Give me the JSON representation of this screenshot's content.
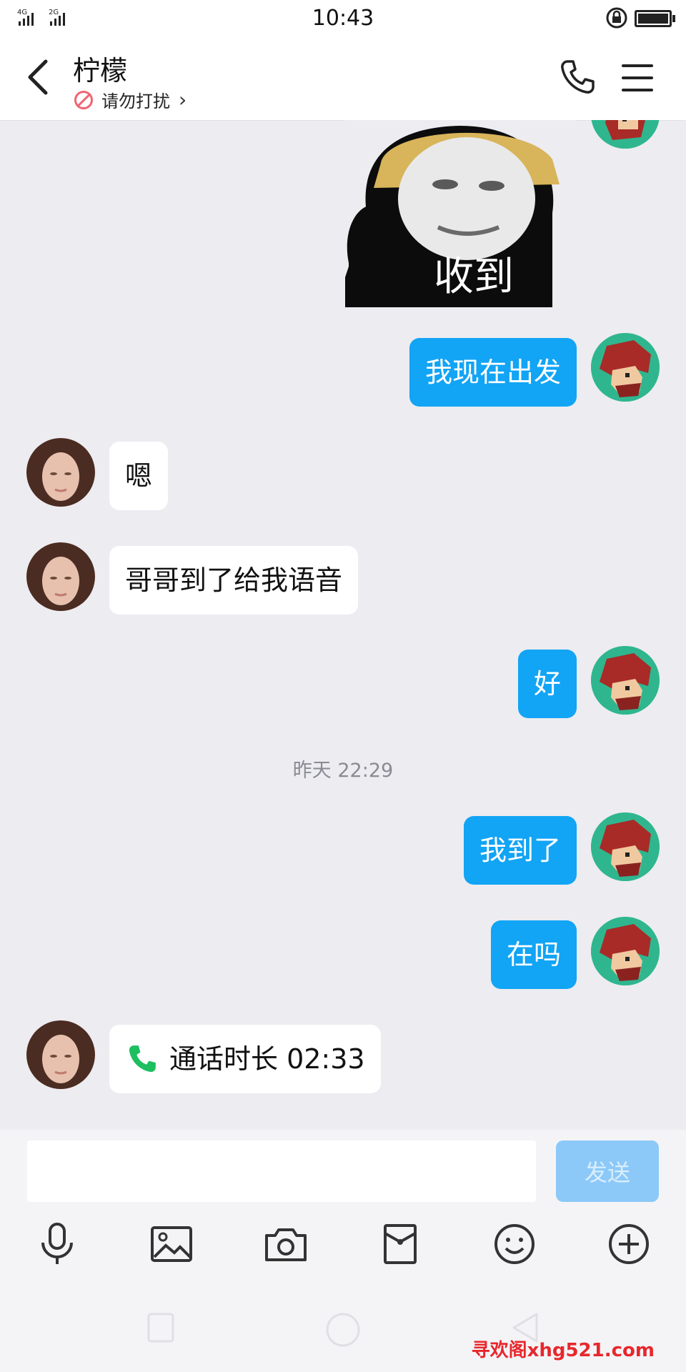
{
  "status_bar": {
    "network": "4G  2G",
    "time": "10:43"
  },
  "header": {
    "title": "柠檬",
    "subtitle": "请勿打扰",
    "chevron": "›"
  },
  "sticker": {
    "caption": "收到"
  },
  "messages": [
    {
      "from": "me",
      "text": "我现在出发"
    },
    {
      "from": "them",
      "text": "嗯"
    },
    {
      "from": "them",
      "text": "哥哥到了给我语音"
    },
    {
      "from": "me",
      "text": "好"
    }
  ],
  "timestamp": "昨天 22:29",
  "messages_after": [
    {
      "from": "me",
      "text": "我到了"
    },
    {
      "from": "me",
      "text": "在吗"
    }
  ],
  "call_record": {
    "text": "通话时长 02:33"
  },
  "input": {
    "placeholder": "",
    "send_label": "发送"
  },
  "toolbar": {
    "icons": [
      "microphone-icon",
      "image-icon",
      "camera-icon",
      "red-packet-icon",
      "emoji-icon",
      "plus-icon"
    ]
  },
  "watermark": "寻欢阁xhg521.com",
  "colors": {
    "bubble_mine": "#12a4f5",
    "bubble_theirs": "#ffffff",
    "send_disabled": "#8cc9f8",
    "call_green": "#1dbf60"
  }
}
